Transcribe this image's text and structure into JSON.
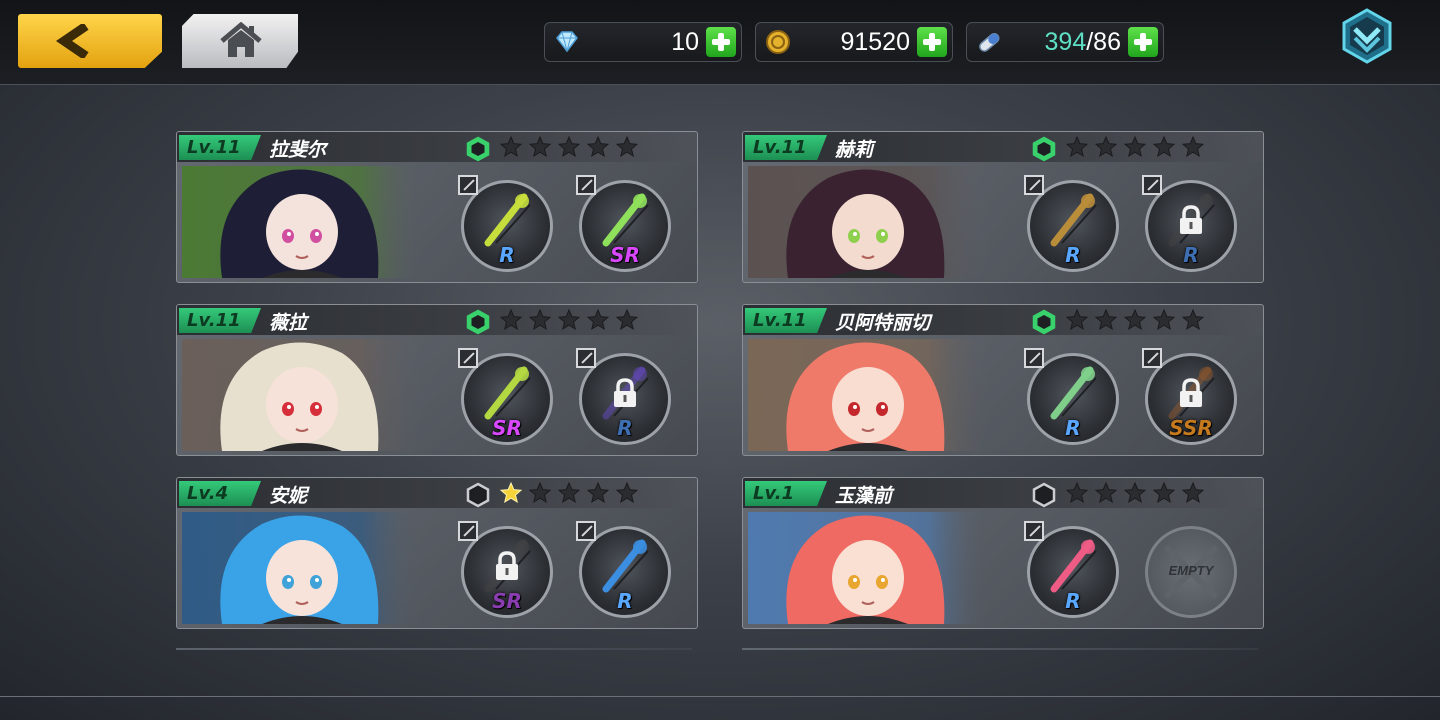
{
  "header": {
    "back_icon": "chevron-left-icon",
    "home_icon": "home-icon",
    "menu_icon": "chevron-down-icon",
    "resources": [
      {
        "icon": "diamond-icon",
        "value": "10",
        "color": "#9ad8f6"
      },
      {
        "icon": "gold-coin-icon",
        "value": "91520",
        "color": "#d9a723"
      },
      {
        "icon": "stamina-capsule-icon",
        "value_current": "394",
        "value_total": "/86",
        "color": "#5fe0c4"
      }
    ]
  },
  "cards": [
    {
      "level": "Lv.11",
      "name": "拉斐尔",
      "stars": 0,
      "hex_color": "#39d16b",
      "portrait": {
        "hair": "#1e1f36",
        "bg": "#4b7a34",
        "skin": "#f4e2dc",
        "eye": "#d14fa0"
      },
      "slots": [
        {
          "rarity": "R",
          "rarity_color": "#5aa7ff",
          "locked": false,
          "weapon_color": "#c6de3c"
        },
        {
          "rarity": "SR",
          "rarity_color": "#d948ff",
          "locked": false,
          "weapon_color": "#8fe05a"
        }
      ]
    },
    {
      "level": "Lv.11",
      "name": "赫莉",
      "stars": 0,
      "hex_color": "#39d16b",
      "portrait": {
        "hair": "#3a2230",
        "bg": "#5b5150",
        "skin": "#f3dccf",
        "eye": "#8fcf4e"
      },
      "slots": [
        {
          "rarity": "R",
          "rarity_color": "#5aa7ff",
          "locked": false,
          "weapon_color": "#b98d3a"
        },
        {
          "rarity": "R",
          "rarity_color": "#3e6fb3",
          "locked": true,
          "weapon_color": "#444"
        }
      ]
    },
    {
      "level": "Lv.11",
      "name": "薇拉",
      "stars": 0,
      "hex_color": "#39d16b",
      "portrait": {
        "hair": "#e8e0cf",
        "bg": "#6a5f59",
        "skin": "#f6e2d8",
        "eye": "#d62e3a"
      },
      "slots": [
        {
          "rarity": "SR",
          "rarity_color": "#d948ff",
          "locked": false,
          "weapon_color": "#b3d842"
        },
        {
          "rarity": "R",
          "rarity_color": "#3e6fb3",
          "locked": true,
          "weapon_color": "#6a4bd1"
        }
      ]
    },
    {
      "level": "Lv.11",
      "name": "贝阿特丽切",
      "stars": 0,
      "hex_color": "#39d16b",
      "portrait": {
        "hair": "#f07a6a",
        "bg": "#7b6756",
        "skin": "#f8ddd0",
        "eye": "#c5282c"
      },
      "slots": [
        {
          "rarity": "R",
          "rarity_color": "#5aa7ff",
          "locked": false,
          "weapon_color": "#7fcf8a"
        },
        {
          "rarity": "SSR",
          "rarity_color": "#c57a1e",
          "locked": true,
          "weapon_color": "#9a5a2a"
        }
      ]
    },
    {
      "level": "Lv.4",
      "name": "安妮",
      "stars": 1,
      "hex_color": "#1b1d20",
      "portrait": {
        "hair": "#3aa3e8",
        "bg": "#2f5b86",
        "skin": "#f7e3da",
        "eye": "#3fa2d8"
      },
      "slots": [
        {
          "rarity": "SR",
          "rarity_color": "#8a3db0",
          "locked": true,
          "weapon_color": "#444"
        },
        {
          "rarity": "R",
          "rarity_color": "#5aa7ff",
          "locked": false,
          "weapon_color": "#3b8ee0"
        }
      ]
    },
    {
      "level": "Lv.1",
      "name": "玉藻前",
      "stars": 0,
      "hex_color": "#1b1d20",
      "portrait": {
        "hair": "#ef6a63",
        "bg": "#4f7ab0",
        "skin": "#f9e0d3",
        "eye": "#e8a530"
      },
      "slots": [
        {
          "rarity": "R",
          "rarity_color": "#5aa7ff",
          "locked": false,
          "weapon_color": "#ee5c86"
        },
        {
          "empty": true,
          "label": "EMPTY"
        }
      ]
    }
  ]
}
